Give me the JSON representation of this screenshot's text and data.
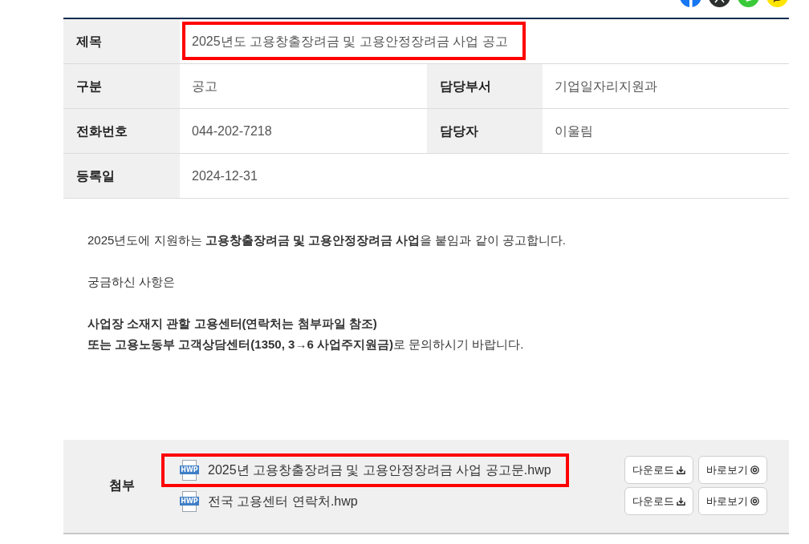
{
  "share_buttons": [
    {
      "kind": "letter_f",
      "color": "#1877f2"
    },
    {
      "kind": "cross",
      "color": "#2b2f2e"
    },
    {
      "kind": "bubble",
      "color": "#3ac93a"
    },
    {
      "kind": "talk",
      "color": "#fee500"
    }
  ],
  "details": {
    "rows": [
      [
        {
          "label": "제목",
          "value": "2025년도 고용창출장려금 및 고용안정장려금 사업 공고",
          "highlighted": true
        }
      ],
      [
        {
          "label": "구분",
          "value": "공고",
          "highlighted": false
        },
        {
          "label": "담당부서",
          "value": "기업일자리지원과",
          "highlighted": false
        }
      ],
      [
        {
          "label": "전화번호",
          "value": "044-202-7218",
          "highlighted": false
        },
        {
          "label": "담당자",
          "value": "이울림",
          "highlighted": false
        }
      ],
      [
        {
          "label": "등록일",
          "value": "2024-12-31",
          "highlighted": false
        }
      ]
    ]
  },
  "body": {
    "paragraphs": [
      "2025년도에 지원하는 **고용창출장려금 및 고용안정장려금 사업**을 붙임과 같이 공고합니다.",
      "궁금하신 사항은",
      "**사업장 소재지 관할 고용센터(연락처는 첨부파일 참조)**\n**또는 고용노동부 고객상담센터(1350, 3→6 사업주지원금)**로 문의하시기 바랍니다."
    ]
  },
  "attachments": {
    "label": "첨부",
    "files": [
      {
        "name": "2025년 고용창출장려금 및 고용안정장려금 사업 공고문.hwp",
        "type": "HWP",
        "highlighted": true,
        "buttons": [
          {
            "kind": "download",
            "label": "다운로드"
          },
          {
            "kind": "preview",
            "label": "바로보기"
          }
        ]
      },
      {
        "name": "전국 고용센터 연락처.hwp",
        "type": "HWP",
        "highlighted": false,
        "buttons": [
          {
            "kind": "download",
            "label": "다운로드"
          },
          {
            "kind": "preview",
            "label": "바로보기"
          }
        ]
      }
    ]
  }
}
